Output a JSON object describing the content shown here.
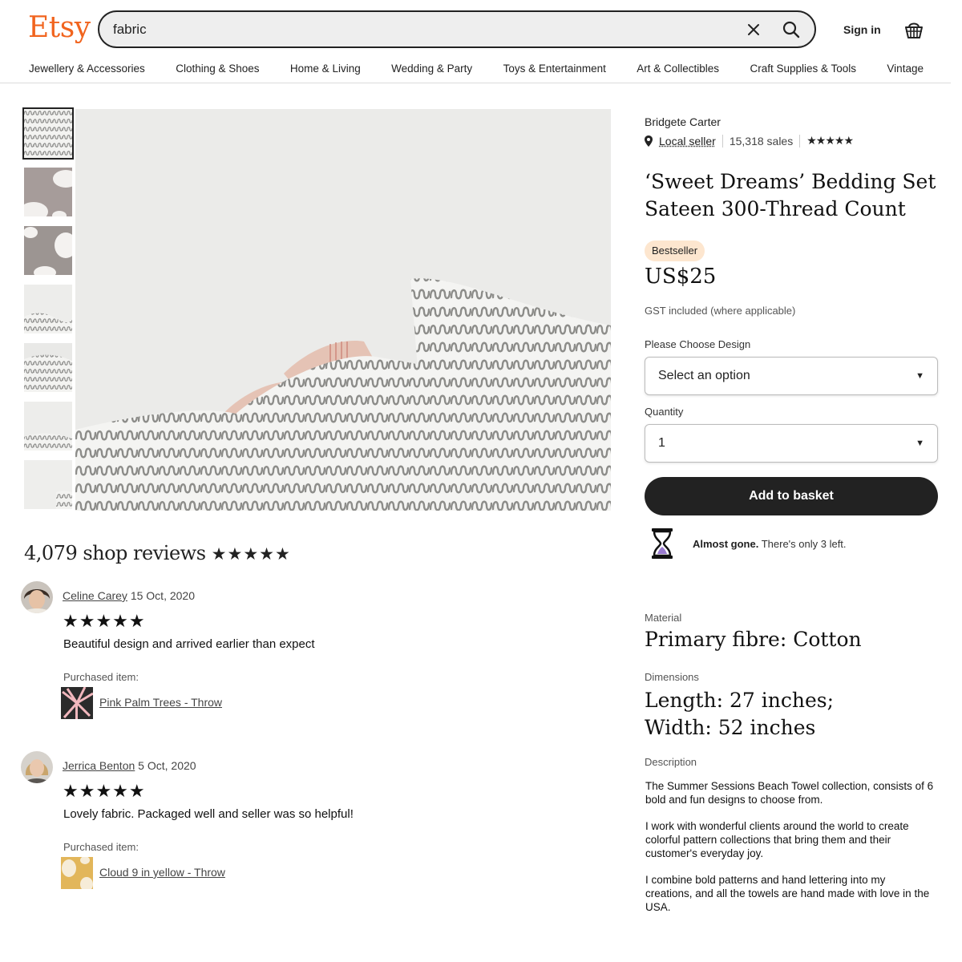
{
  "header": {
    "logo": "Etsy",
    "search_value": "fabric",
    "signin_label": "Sign in"
  },
  "nav": [
    "Jewellery & Accessories",
    "Clothing & Shoes",
    "Home & Living",
    "Wedding & Party",
    "Toys & Entertainment",
    "Art & Collectibles",
    "Craft Supplies & Tools",
    "Vintage"
  ],
  "product": {
    "seller_name": "Bridgete Carter",
    "local_seller": "Local seller",
    "sales": "15,318 sales",
    "seller_stars": "★★★★★",
    "title": "‘Sweet Dreams’ Bedding Set Sateen 300-Thread Count",
    "badge": "Bestseller",
    "price": "US$25",
    "gst": "GST included (where applicable)",
    "design_label": "Please Choose Design",
    "design_value": "Select an option",
    "quantity_label": "Quantity",
    "quantity_value": "1",
    "add_label": "Add to basket",
    "almost_bold": "Almost gone.",
    "almost_rest": " There's only 3 left."
  },
  "details": {
    "material_label": "Material",
    "material_value": "Primary fibre: Cotton",
    "dimensions_label": "Dimensions",
    "dimensions_line1": "Length: 27 inches;",
    "dimensions_line2": "Width: 52 inches",
    "description_label": "Description",
    "description": [
      "The Summer Sessions Beach Towel collection, consists of 6 bold and fun designs to choose from.",
      "I work with wonderful clients around the world to create colorful pattern collections that bring them and their customer's everyday joy.",
      "I combine bold patterns and hand lettering into my creations, and all the towels are hand made with love in the USA."
    ]
  },
  "reviews": {
    "title": "4,079 shop reviews",
    "title_stars": "★★★★★",
    "items": [
      {
        "name": "Celine Carey",
        "date": "15 Oct, 2020",
        "stars": "★★★★★",
        "text": "Beautiful design and arrived earlier than expect",
        "purchased_label": "Purchased item:",
        "item": "Pink Palm Trees - Throw"
      },
      {
        "name": "Jerrica Benton",
        "date": "5 Oct, 2020",
        "stars": "★★★★★",
        "text": "Lovely fabric. Packaged well and seller was so helpful!",
        "purchased_label": "Purchased item:",
        "item": "Cloud 9 in yellow - Throw"
      }
    ]
  },
  "colors": {
    "brand": "#f1641e",
    "button": "#222222",
    "badge": "#fde6cf"
  },
  "icons": [
    "close-icon",
    "search-icon",
    "basket-icon",
    "location-pin-icon",
    "hourglass-icon",
    "caret-down-icon"
  ]
}
